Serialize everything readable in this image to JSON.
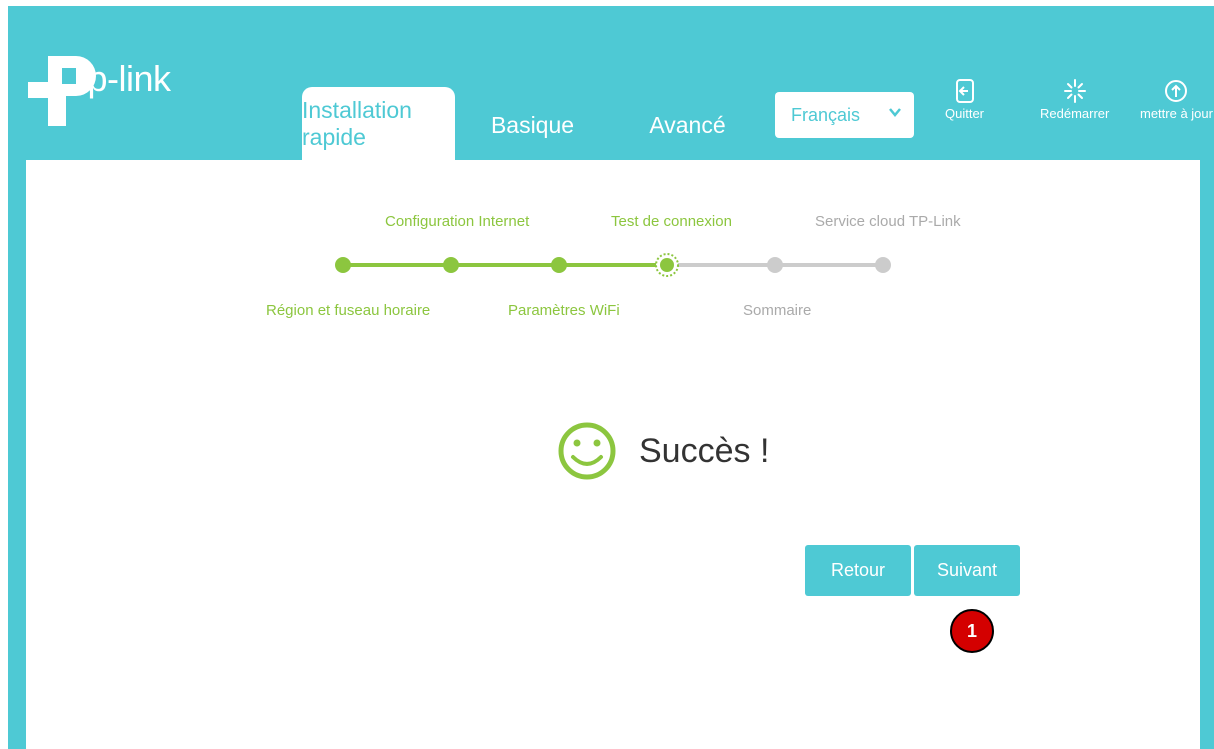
{
  "brand": {
    "name": "tp-link"
  },
  "nav": {
    "tabs": [
      {
        "label": "Installation rapide",
        "active": true
      },
      {
        "label": "Basique",
        "active": false
      },
      {
        "label": "Avancé",
        "active": false
      }
    ],
    "language": "Français",
    "tools": [
      {
        "label": "Quitter",
        "icon": "exit-icon"
      },
      {
        "label": "Redémarrer",
        "icon": "reboot-icon"
      },
      {
        "label": "mettre à jour",
        "icon": "upgrade-icon"
      }
    ]
  },
  "stepper": {
    "steps": [
      {
        "label": "Région et fuseau horaire",
        "state": "done"
      },
      {
        "label": "Configuration Internet",
        "state": "done"
      },
      {
        "label": "Paramètres WiFi",
        "state": "done"
      },
      {
        "label": "Test de connexion",
        "state": "current"
      },
      {
        "label": "Sommaire",
        "state": "pending"
      },
      {
        "label": "Service cloud TP-Link",
        "state": "pending"
      }
    ]
  },
  "result": {
    "message": "Succès !",
    "icon": "smiley-icon"
  },
  "actions": {
    "back_label": "Retour",
    "next_label": "Suivant"
  },
  "annotation": {
    "marker": "1"
  },
  "colors": {
    "accent": "#4ec9d4",
    "success": "#8cc63f",
    "pending": "#cccccc",
    "marker": "#d40000"
  }
}
